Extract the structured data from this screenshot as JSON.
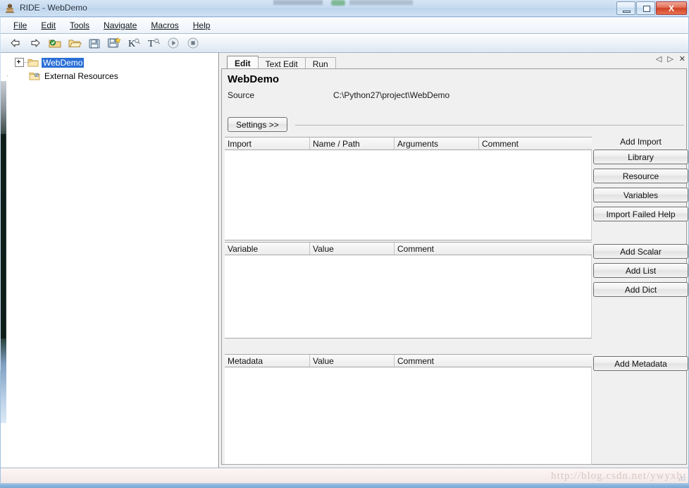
{
  "window": {
    "title": "RIDE - WebDemo",
    "app_icon": "robot-icon",
    "minimize_label": "Minimize",
    "maximize_label": "Maximize",
    "close_label": "X"
  },
  "menu": {
    "items": [
      {
        "label": "File",
        "accel": "F"
      },
      {
        "label": "Edit",
        "accel": "E"
      },
      {
        "label": "Tools",
        "accel": "T"
      },
      {
        "label": "Navigate",
        "accel": "N"
      },
      {
        "label": "Macros",
        "accel": "M"
      },
      {
        "label": "Help",
        "accel": "H"
      }
    ]
  },
  "toolbar": {
    "buttons": [
      {
        "name": "back-icon",
        "glyph": "⇦"
      },
      {
        "name": "forward-icon",
        "glyph": "⇨"
      },
      {
        "name": "new-project-icon",
        "glyph": "▣"
      },
      {
        "name": "open-folder-icon",
        "glyph": "▱"
      },
      {
        "name": "save-icon",
        "glyph": "▤"
      },
      {
        "name": "save-all-icon",
        "glyph": "▥"
      },
      {
        "name": "keyword-search-icon",
        "glyph": "K"
      },
      {
        "name": "text-search-icon",
        "glyph": "T"
      },
      {
        "name": "run-icon",
        "glyph": "▶"
      },
      {
        "name": "stop-icon",
        "glyph": "■"
      }
    ]
  },
  "tree": {
    "root": {
      "label": "WebDemo",
      "selected": true,
      "expander": "+",
      "icon": "folder-icon"
    },
    "child": {
      "label": "External Resources",
      "selected": false,
      "icon": "folder-link-icon"
    }
  },
  "tabs": {
    "items": [
      {
        "label": "Edit",
        "active": true
      },
      {
        "label": "Text Edit",
        "active": false
      },
      {
        "label": "Run",
        "active": false
      }
    ],
    "nav": {
      "prev": "◁",
      "next": "▷",
      "close": "✕"
    }
  },
  "editor": {
    "title": "WebDemo",
    "source_label": "Source",
    "source_value": "C:\\Python27\\project\\WebDemo",
    "settings_button": "Settings >>"
  },
  "import_grid": {
    "columns": [
      "Import",
      "Name / Path",
      "Arguments",
      "Comment"
    ],
    "rows": []
  },
  "import_actions": {
    "heading": "Add Import",
    "buttons": [
      "Library",
      "Resource",
      "Variables",
      "Import Failed Help"
    ]
  },
  "variable_grid": {
    "columns": [
      "Variable",
      "Value",
      "Comment"
    ],
    "rows": []
  },
  "variable_actions": {
    "buttons": [
      "Add Scalar",
      "Add List",
      "Add Dict"
    ]
  },
  "metadata_grid": {
    "columns": [
      "Metadata",
      "Value",
      "Comment"
    ],
    "rows": []
  },
  "metadata_actions": {
    "buttons": [
      "Add Metadata"
    ]
  },
  "status_bar": {
    "watermark": "http://blog.csdn.net/ywyxb"
  },
  "colors": {
    "selection_blue": "#2a6fd6",
    "close_red": "#cf4226",
    "window_chrome": "#c4d9ef",
    "panel_gray": "#f0f0f0",
    "grid_border": "#a8a8a8"
  }
}
